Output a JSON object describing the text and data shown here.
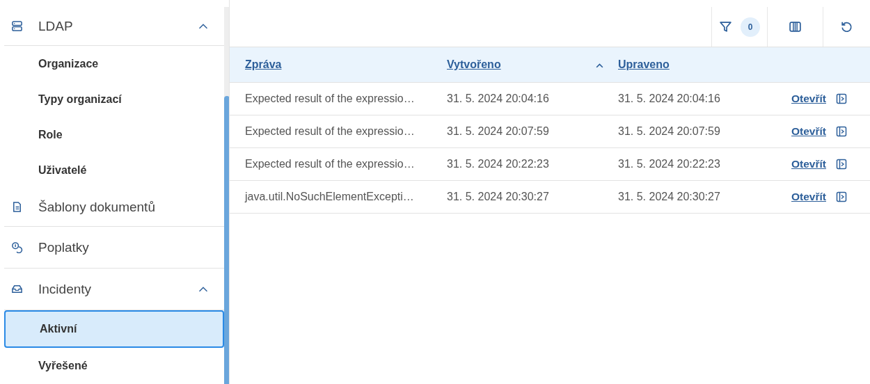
{
  "sidebar": {
    "items": [
      {
        "kind": "group",
        "label": "LDAP",
        "expanded": true,
        "children": [
          {
            "label": "Organizace",
            "selected": false
          },
          {
            "label": "Typy organizací",
            "selected": false
          },
          {
            "label": "Role",
            "selected": false
          },
          {
            "label": "Uživatelé",
            "selected": false
          }
        ]
      },
      {
        "kind": "link",
        "label": "Šablony dokumentů"
      },
      {
        "kind": "link",
        "label": "Poplatky"
      },
      {
        "kind": "group",
        "label": "Incidenty",
        "expanded": true,
        "children": [
          {
            "label": "Aktivní",
            "selected": true
          },
          {
            "label": "Vyřešené",
            "selected": false
          }
        ]
      }
    ]
  },
  "toolbar": {
    "filter_count": "0"
  },
  "table": {
    "columns": [
      {
        "label": "Zpráva",
        "sorted": false
      },
      {
        "label": "Vytvořeno",
        "sorted": true
      },
      {
        "label": "Upraveno",
        "sorted": false
      }
    ],
    "rows": [
      {
        "cells": [
          "Expected result of the expressio…",
          "31. 5. 2024 20:04:16",
          "31. 5. 2024 20:04:16"
        ],
        "action": "Otevřít"
      },
      {
        "cells": [
          "Expected result of the expressio…",
          "31. 5. 2024 20:07:59",
          "31. 5. 2024 20:07:59"
        ],
        "action": "Otevřít"
      },
      {
        "cells": [
          "Expected result of the expressio…",
          "31. 5. 2024 20:22:23",
          "31. 5. 2024 20:22:23"
        ],
        "action": "Otevřít"
      },
      {
        "cells": [
          "java.util.NoSuchElementExcepti…",
          "31. 5. 2024 20:30:27",
          "31. 5. 2024 20:30:27"
        ],
        "action": "Otevřít"
      }
    ]
  }
}
